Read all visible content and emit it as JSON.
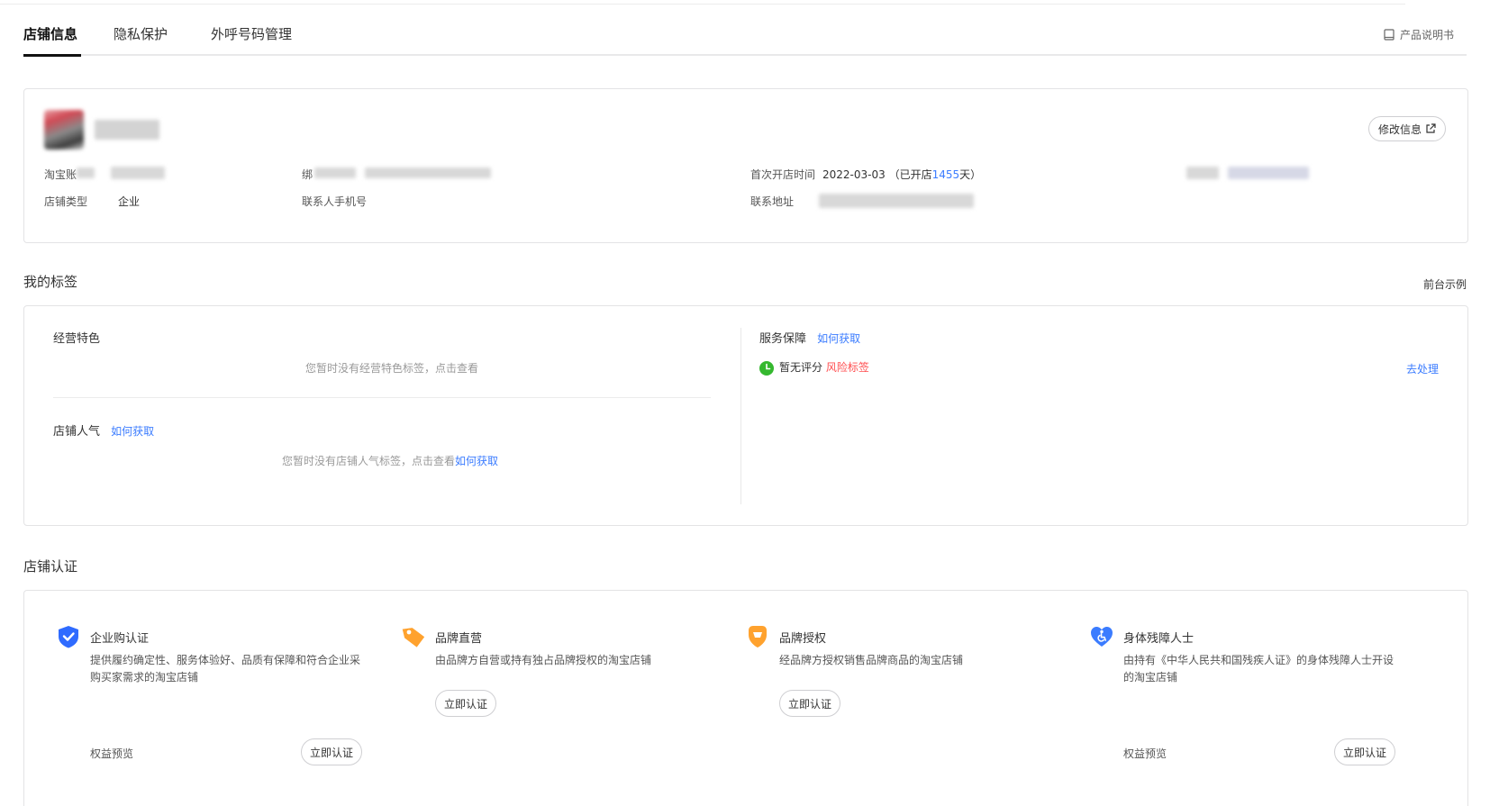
{
  "tabs": [
    {
      "label": "店铺信息",
      "active": true
    },
    {
      "label": "隐私保护",
      "active": false
    },
    {
      "label": "外呼号码管理",
      "active": false
    }
  ],
  "manual_link": "产品说明书",
  "shop_info": {
    "edit_button": "修改信息",
    "taobao_account_label": "淘宝账",
    "bind_label": "绑",
    "first_open_label": "首次开店时间",
    "first_open_date": "2022-03-03",
    "opened_prefix": "（已开店",
    "opened_days": "1455",
    "opened_suffix": "天）",
    "shop_type_label": "店铺类型",
    "shop_type_value": "企业",
    "contact_phone_label": "联系人手机号",
    "contact_address_label": "联系地址"
  },
  "my_tags": {
    "title": "我的标签",
    "front_example": "前台示例",
    "business_feature_title": "经营特色",
    "business_feature_empty": "您暂时没有经营特色标签，点击查看",
    "popularity_title": "店铺人气",
    "popularity_link": "如何获取",
    "popularity_empty": "您暂时没有店铺人气标签，点击查看",
    "popularity_empty_link": "如何获取",
    "service_title": "服务保障",
    "service_link": "如何获取",
    "no_rating": "暂无评分",
    "risk_tag": "风险标签",
    "handle_link": "去处理"
  },
  "certification": {
    "title": "店铺认证",
    "items": [
      {
        "icon": "shield-check-icon",
        "color": "#2f6bff",
        "title": "企业购认证",
        "desc": "提供履约确定性、服务体验好、品质有保障和符合企业采购买家需求的淘宝店铺",
        "benefit": "权益预览",
        "button": "立即认证"
      },
      {
        "icon": "tag-icon",
        "color": "#ffa22e",
        "title": "品牌直营",
        "desc": "由品牌方自营或持有独占品牌授权的淘宝店铺",
        "button": "立即认证"
      },
      {
        "icon": "diamond-badge-icon",
        "color": "#ffa22e",
        "title": "品牌授权",
        "desc": "经品牌方授权销售品牌商品的淘宝店铺",
        "button": "立即认证"
      },
      {
        "icon": "accessibility-heart-icon",
        "color": "#3b7cff",
        "title": "身体残障人士",
        "desc": "由持有《中华人民共和国残疾人证》的身体残障人士开设的淘宝店铺",
        "benefit": "权益预览",
        "button": "立即认证"
      }
    ]
  }
}
